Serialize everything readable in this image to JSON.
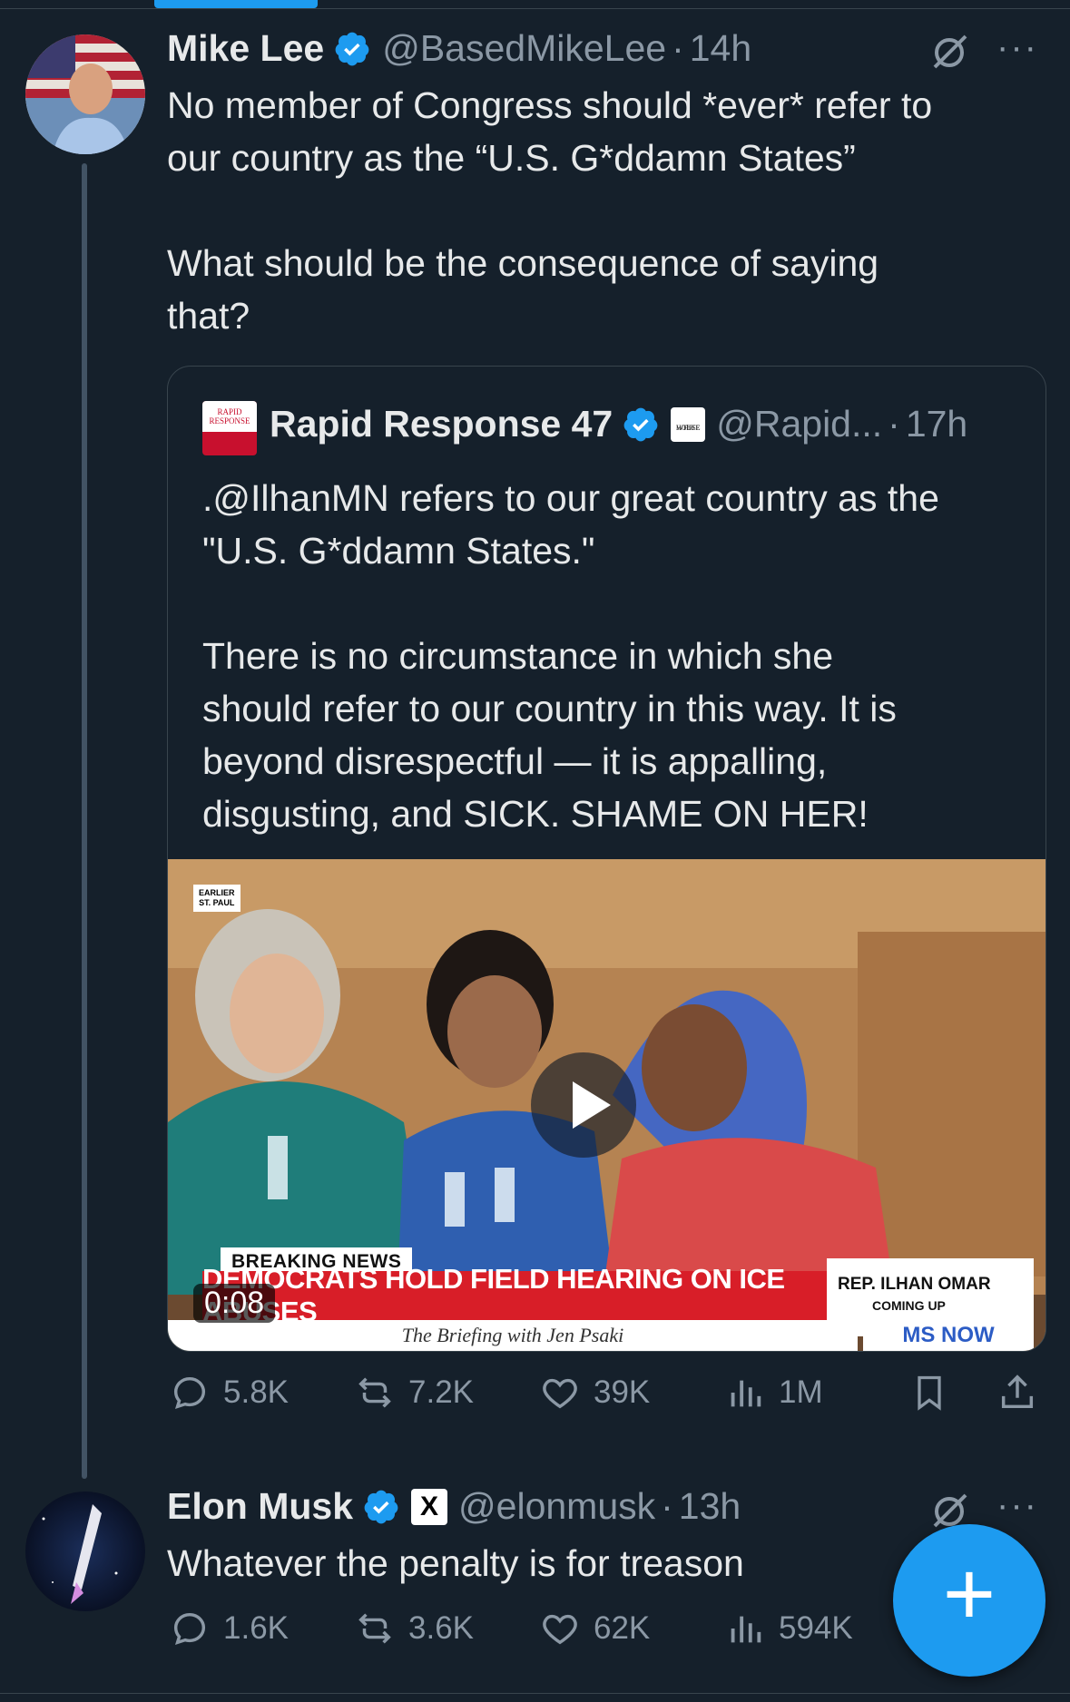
{
  "tweet1": {
    "name": "Mike Lee",
    "handle": "@BasedMikeLee",
    "time": "14h",
    "text": "No member of Congress should *ever* refer to\nour country as the “U.S. G*ddamn States”\n\nWhat should be the consequence of saying\nthat?",
    "more": "···",
    "stats": {
      "replies": "5.8K",
      "reposts": "7.2K",
      "likes": "39K",
      "views": "1M"
    }
  },
  "quote": {
    "name": "Rapid Response 47",
    "handle": "@Rapid...",
    "time": "17h",
    "logo_text": [
      "RAPID",
      "RESPONSE"
    ],
    "affiliate_badge": [
      "The",
      "WHITE",
      "HOUSE"
    ],
    "text": ".@IlhanMN refers to our great country as the\n\"U.S. G*ddamn States.\"\n\nThere is no circumstance in which she\nshould refer to our country in this way. It is\nbeyond disrespectful — it is appalling,\ndisgusting, and SICK. SHAME ON HER!",
    "video": {
      "duration": "0:08",
      "breaking": "BREAKING NEWS",
      "headline": "DEMOCRATS HOLD FIELD HEARING ON ICE ABUSES",
      "briefing": "The Briefing with Jen Psaki",
      "rep_name": "REP. ILHAN OMAR",
      "rep_sub": "COMING UP",
      "network": "MS NOW",
      "earlier": [
        "EARLIER",
        "ST. PAUL"
      ]
    }
  },
  "tweet2": {
    "name": "Elon Musk",
    "handle": "@elonmusk",
    "time": "13h",
    "affiliate_badge": "X",
    "text": "Whatever the penalty is for treason",
    "more": "···",
    "stats": {
      "replies": "1.6K",
      "reposts": "3.6K",
      "likes": "62K",
      "views": "594K"
    }
  },
  "fab": {
    "label": "+"
  },
  "colors": {
    "background": "#15202b",
    "accent": "#1d9bf0",
    "muted": "#8b98a5",
    "text": "#e7e9ea"
  },
  "icons": [
    "verified-icon",
    "grok-icon",
    "reply-icon",
    "repost-icon",
    "like-icon",
    "views-icon",
    "bookmark-icon",
    "share-icon",
    "play-icon",
    "compose-icon"
  ]
}
